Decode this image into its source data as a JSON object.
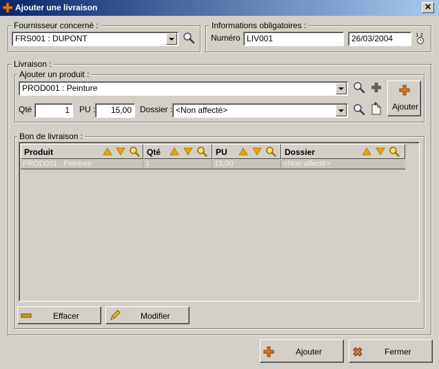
{
  "window": {
    "title": "Ajouter une livraison",
    "close_glyph": "✕"
  },
  "fournisseur": {
    "legend": "Fournisseur concerné :",
    "value": "FRS001 : DUPONT"
  },
  "infos": {
    "legend": "Informations obligatoires :",
    "numero_label": "Numéro :",
    "numero_value": "LIV001",
    "date_value": "26/03/2004"
  },
  "livraison": {
    "legend": "Livraison :",
    "ajouter_produit": {
      "legend": "Ajouter un produit :",
      "produit_value": "PROD001 : Peinture",
      "qte_label": "Qté :",
      "qte_value": "1",
      "pu_label": "PU :",
      "pu_value": "15,00",
      "dossier_label": "Dossier :",
      "dossier_value": "<Non affecté>",
      "ajouter_button": "Ajouter"
    },
    "bon": {
      "legend": "Bon de livraison :",
      "columns": [
        "Produit",
        "Qté",
        "PU",
        "Dossier"
      ],
      "rows": [
        [
          "PROD001 : Peinture",
          "1",
          "15,00",
          "<Non affecté>"
        ]
      ],
      "effacer_button": "Effacer",
      "modifier_button": "Modifier"
    }
  },
  "footer": {
    "ajouter_button": "Ajouter",
    "fermer_button": "Fermer"
  },
  "icons": {
    "app": "plus-icon",
    "search": "search-icon",
    "calendar": "calendar-clock-icon",
    "add": "plus-icon",
    "new_doc": "new-document-icon",
    "sort_up": "sort-ascending-icon",
    "sort_down": "sort-descending-icon",
    "erase": "eraser-icon",
    "edit": "pencil-icon",
    "close": "close-x-icon"
  },
  "colors": {
    "window_bg": "#d4d0c8",
    "titlebar_start": "#0a246a",
    "titlebar_end": "#a6caf0",
    "accent_orange": "#e07820",
    "sort_arrow": "#e8a800"
  }
}
